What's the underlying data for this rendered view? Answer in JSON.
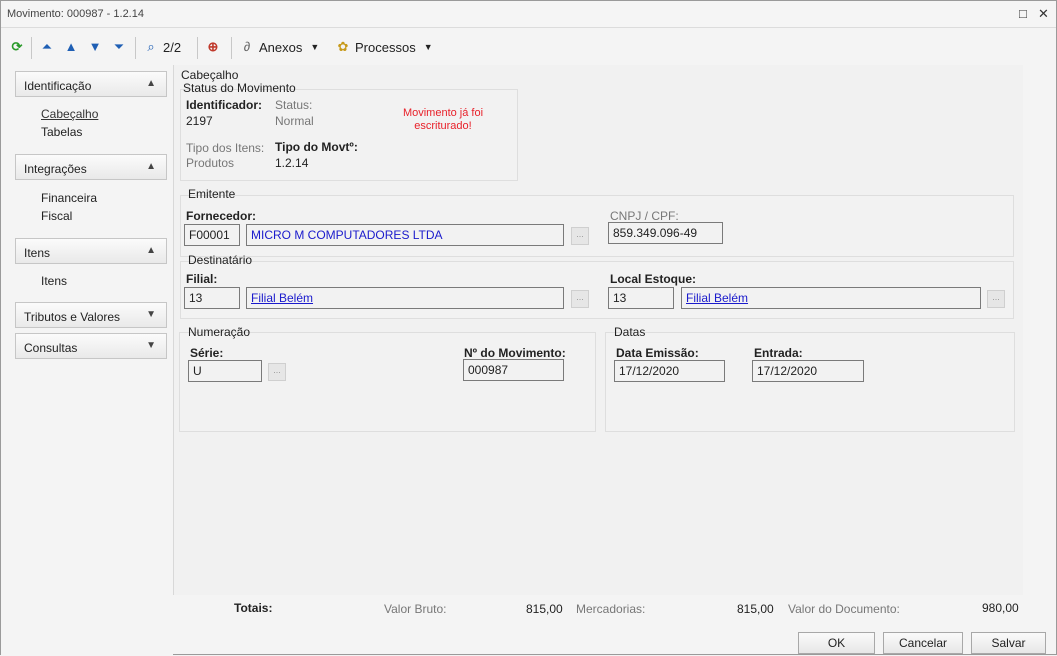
{
  "window": {
    "title": "Movimento: 000987 - 1.2.14",
    "controls": {
      "restore": "□",
      "close": "✕"
    }
  },
  "toolbar": {
    "refresh_icon": "refresh-icon",
    "page_counter": "2/2",
    "anexos_label": "Anexos",
    "processos_label": "Processos"
  },
  "sidebar": {
    "sections": [
      {
        "label": "Identificação",
        "items": [
          "Cabeçalho",
          "Tabelas"
        ]
      },
      {
        "label": "Integrações",
        "items": [
          "Financeira",
          "Fiscal"
        ]
      },
      {
        "label": "Itens",
        "items": [
          "Itens"
        ]
      },
      {
        "label": "Tributos e Valores",
        "items": []
      },
      {
        "label": "Consultas",
        "items": []
      }
    ]
  },
  "header": {
    "section_title": "Cabeçalho",
    "status_group": {
      "title": "Status do Movimento",
      "identificador_label": "Identificador:",
      "identificador_value": "2197",
      "status_label": "Status:",
      "status_value": "Normal",
      "message": "Movimento já foi escriturado!",
      "tipo_itens_label": "Tipo dos Itens:",
      "tipo_itens_value": "Produtos",
      "tipo_movto_label": "Tipo do Movtº:",
      "tipo_movto_value": "1.2.14"
    },
    "emitente": {
      "title": "Emitente",
      "fornecedor_label": "Fornecedor:",
      "fornecedor_code": "F00001",
      "fornecedor_name": "MICRO M COMPUTADORES LTDA",
      "cnpj_label": "CNPJ / CPF:",
      "cnpj_value": "859.349.096-49"
    },
    "destinatario": {
      "title": "Destinatário",
      "filial_label": "Filial:",
      "filial_code": "13",
      "filial_name": "Filial Belém",
      "local_label": "Local Estoque:",
      "local_code": "13",
      "local_name": "Filial Belém"
    },
    "numeracao": {
      "title": "Numeração",
      "serie_label": "Série:",
      "serie_value": "U",
      "numero_label": "Nº do Movimento:",
      "numero_value": "000987"
    },
    "datas": {
      "title": "Datas",
      "emissao_label": "Data Emissão:",
      "emissao_value": "17/12/2020",
      "entrada_label": "Entrada:",
      "entrada_value": "17/12/2020"
    }
  },
  "totals": {
    "label": "Totais:",
    "valor_bruto_label": "Valor Bruto:",
    "valor_bruto_value": "815,00",
    "mercadorias_label": "Mercadorias:",
    "mercadorias_value": "815,00",
    "valor_documento_label": "Valor do Documento:",
    "valor_documento_value": "980,00"
  },
  "footer": {
    "ok_label": "OK",
    "cancel_label": "Cancelar",
    "save_label": "Salvar"
  },
  "colors": {
    "link": "#1a1acc",
    "message_red": "#e8212a"
  }
}
